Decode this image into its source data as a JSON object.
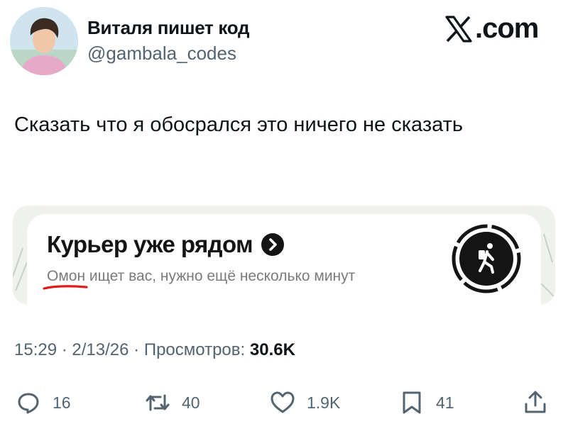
{
  "author": {
    "display_name": "Виталя пишет код",
    "handle": "@gambala_codes",
    "avatar_icon": "avatar-photo"
  },
  "brand": {
    "label": ".com",
    "icon": "x-logo-icon"
  },
  "tweet": {
    "text": "Сказать что я обосрался это ничего не сказать"
  },
  "media": {
    "title": "Курьер уже рядом",
    "subtitle_underlined": "Омон",
    "subtitle_rest": " ищет вас, нужно ещё несколько минут",
    "accent_underline_color": "#e01b1b",
    "courier_icon": "walking-person-icon"
  },
  "meta": {
    "time": "15:29",
    "date": "2/13/26",
    "views_label": "Просмотров:",
    "views_count": "30.6K"
  },
  "actions": {
    "replies": "16",
    "reposts": "40",
    "likes": "1.9K",
    "bookmarks": "41"
  }
}
